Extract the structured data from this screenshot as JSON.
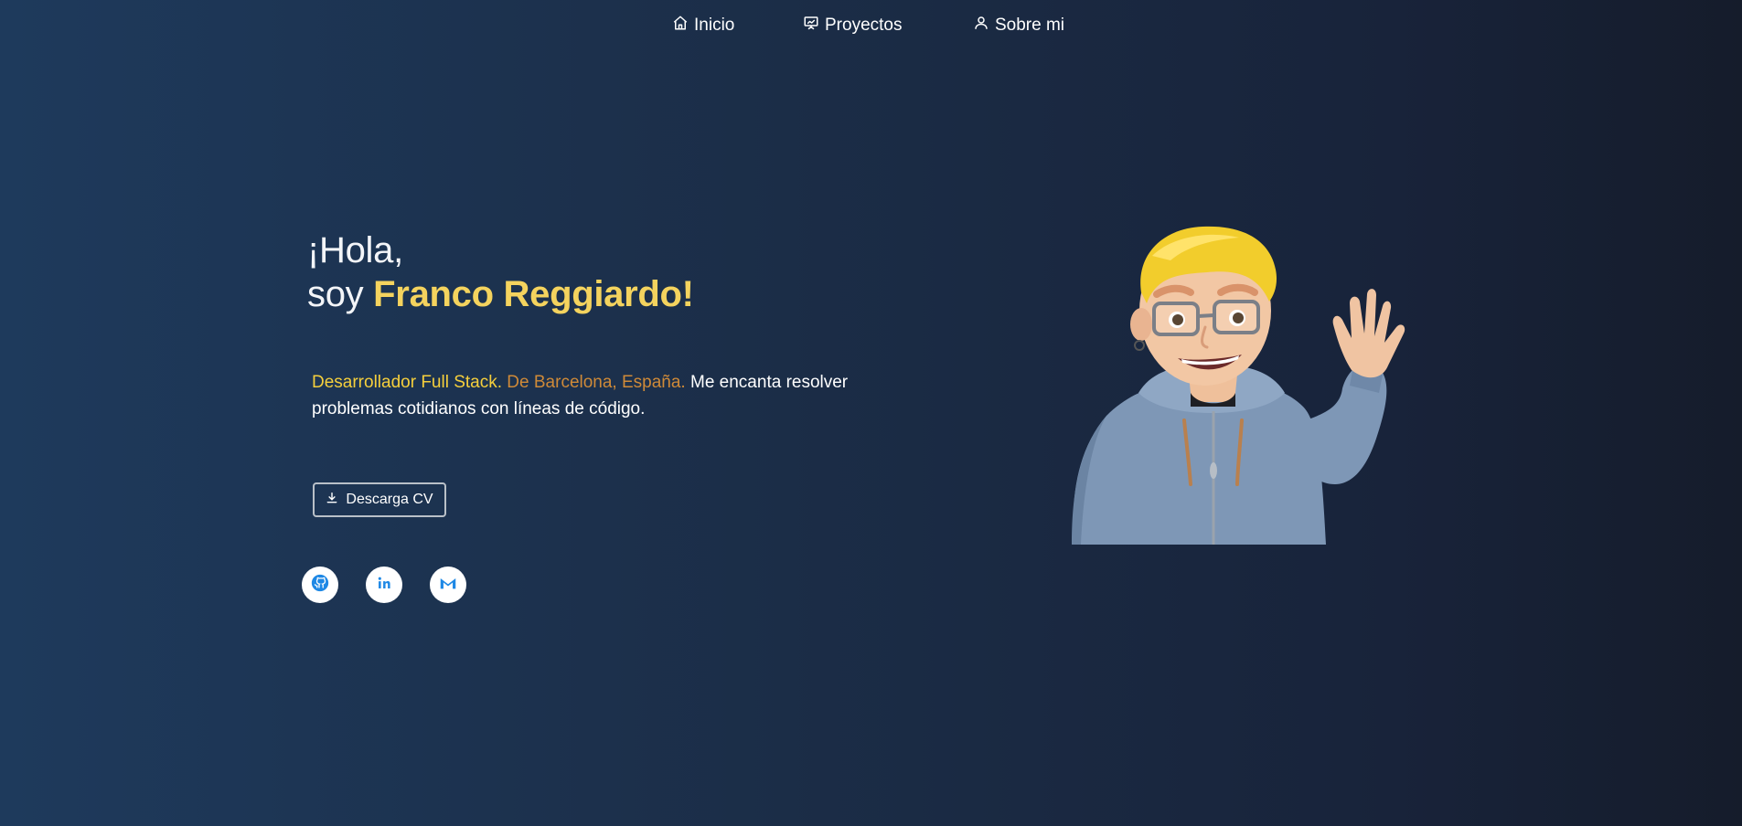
{
  "nav": {
    "items": [
      {
        "label": "Inicio",
        "icon": "home-icon"
      },
      {
        "label": "Proyectos",
        "icon": "presentation-icon"
      },
      {
        "label": "Sobre mi",
        "icon": "user-icon"
      }
    ]
  },
  "hero": {
    "greeting": "¡Hola,",
    "soy": "soy ",
    "name": "Franco Reggiardo!",
    "role": "Desarrollador Full Stack.",
    "location": " De Barcelona, España.",
    "description": " Me encanta resolver problemas cotidianos con líneas de código.",
    "cv_button": "Descarga CV"
  },
  "social": [
    {
      "icon": "github-icon"
    },
    {
      "icon": "linkedin-icon"
    },
    {
      "icon": "gmail-icon"
    }
  ],
  "colors": {
    "accent_name": "#f4d35e",
    "accent_role": "#f5cf3c",
    "accent_place": "#cf8a38",
    "social_icon": "#1e88e5"
  }
}
